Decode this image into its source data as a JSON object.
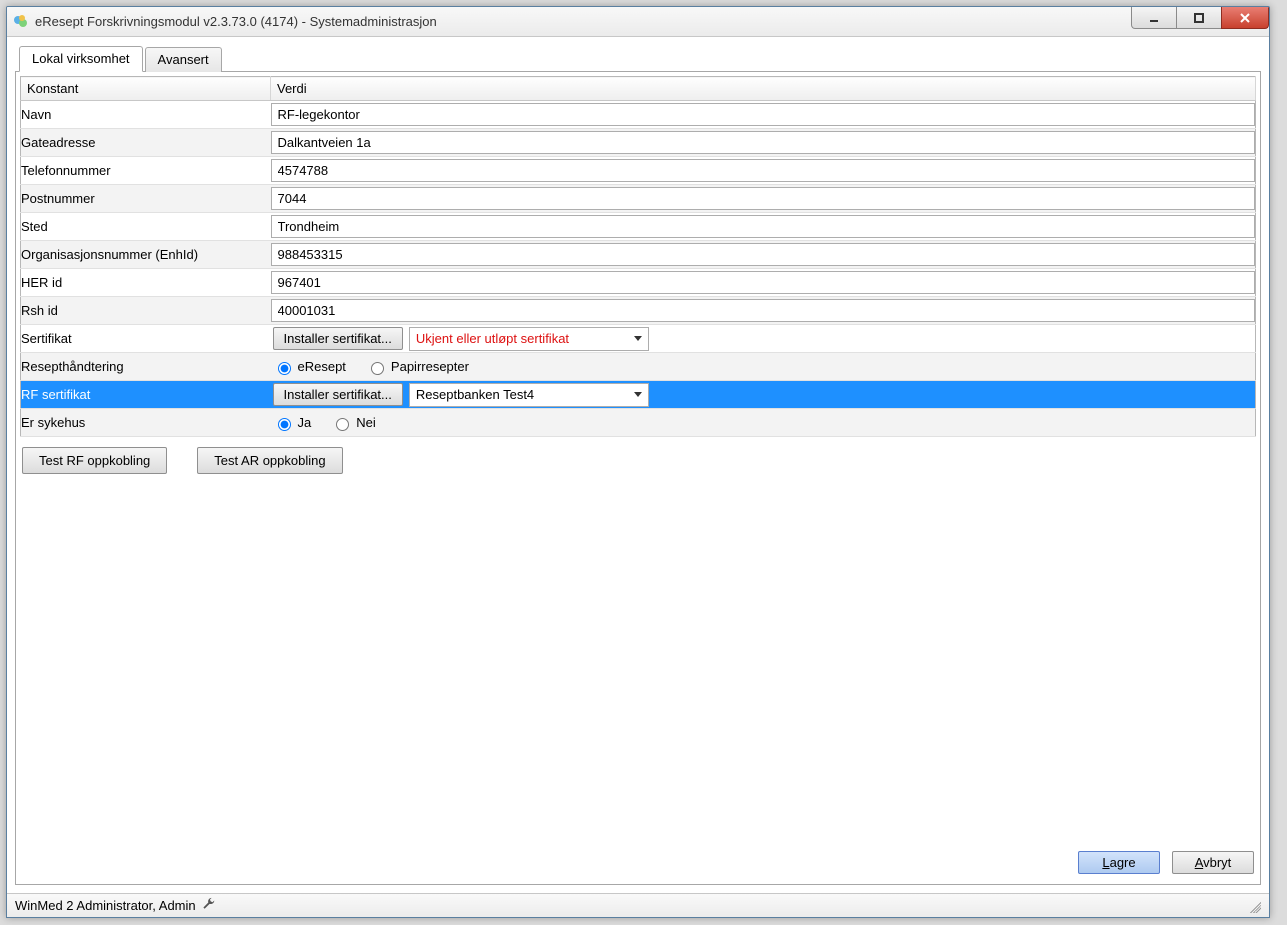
{
  "window": {
    "title": "eResept Forskrivningsmodul v2.3.73.0 (4174) - Systemadministrasjon"
  },
  "tabs": {
    "local": "Lokal virksomhet",
    "advanced": "Avansert"
  },
  "header": {
    "konstant": "Konstant",
    "verdi": "Verdi"
  },
  "rows": {
    "navn_label": "Navn",
    "navn_value": "RF-legekontor",
    "gate_label": "Gateadresse",
    "gate_value": "Dalkantveien 1a",
    "tel_label": "Telefonnummer",
    "tel_value": "4574788",
    "post_label": "Postnummer",
    "post_value": "7044",
    "sted_label": "Sted",
    "sted_value": "Trondheim",
    "org_label": "Organisasjonsnummer (EnhId)",
    "org_value": "988453315",
    "her_label": "HER id",
    "her_value": "967401",
    "rsh_label": "Rsh id",
    "rsh_value": "40001031",
    "sert_label": "Sertifikat",
    "sert_button": "Installer sertifikat...",
    "sert_dropdown": "Ukjent eller utløpt sertifikat",
    "resept_label": "Resepthåndtering",
    "resept_opt1": "eResept",
    "resept_opt2": "Papirresepter",
    "rfsert_label": "RF sertifikat",
    "rfsert_button": "Installer sertifikat...",
    "rfsert_dropdown": "Reseptbanken Test4",
    "sykehus_label": "Er sykehus",
    "sykehus_opt1": "Ja",
    "sykehus_opt2": "Nei"
  },
  "buttons": {
    "test_rf": "Test RF oppkobling",
    "test_ar": "Test AR oppkobling",
    "save": "Lagre",
    "cancel": "Avbryt"
  },
  "status": {
    "text": "WinMed 2 Administrator, Admin"
  }
}
